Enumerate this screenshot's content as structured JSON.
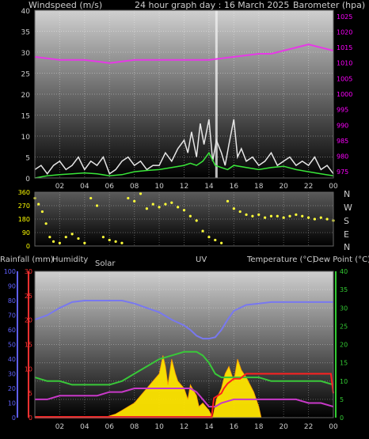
{
  "colors": {
    "background": "#000000",
    "panel_light": "#c8c8c8",
    "panel_dark": "#000000",
    "windspeed_gust": "#e6e6e6",
    "windspeed_avg": "#39e639",
    "barometer": "#e639e6",
    "wind_direction": "#ffff39",
    "humidity": "#7878f0",
    "temperature": "#39c839",
    "dew_point": "#c839c8",
    "rainfall": "#ff2020",
    "solar": "#ffe600",
    "uv": "#ff9a00",
    "axis_wind": "#cccccc",
    "axis_baro": "#ff00ff",
    "axis_dir": "#ffff00",
    "axis_hum": "#6060ff",
    "axis_rain": "#ff3030",
    "axis_temp": "#33cc33"
  },
  "header": {
    "windspeed_label": "Windspeed (m/s)",
    "title": "24 hour graph day : 16 March 2025",
    "barometer_label": "Barometer (hpa)"
  },
  "compass": {
    "n": "N",
    "w": "W",
    "s": "S",
    "e": "E",
    "n2": "N"
  },
  "bottom_header": {
    "rainfall": "Rainfall (mm)",
    "humidity": "Humidity",
    "solar": "Solar",
    "uv": "UV",
    "temperature": "Temperature (°C)",
    "dew_point": "Dew Point (°C)"
  },
  "chart_data": [
    {
      "type": "line",
      "x_ticks": [
        "02",
        "04",
        "06",
        "08",
        "10",
        "12",
        "14",
        "16",
        "18",
        "20",
        "22",
        "00"
      ],
      "x_hours": [
        0,
        24
      ],
      "y_left_ticks": [
        "0",
        "5",
        "10",
        "15",
        "20",
        "25",
        "30",
        "35",
        "40"
      ],
      "y_left_lim": [
        0,
        40
      ],
      "y_right_ticks": [
        "975",
        "980",
        "985",
        "990",
        "995",
        "1000",
        "1005",
        "1010",
        "1015",
        "1020",
        "1025"
      ],
      "y_right_lim": [
        973,
        1027
      ],
      "grid": true,
      "series": [
        {
          "role": "barometer",
          "axis": "right",
          "x": [
            0,
            2,
            4,
            6,
            8,
            10,
            12,
            14,
            16,
            18,
            19,
            20,
            21,
            22,
            23,
            24
          ],
          "y": [
            1012,
            1011,
            1011,
            1010,
            1011,
            1011,
            1011,
            1011,
            1012,
            1013,
            1013,
            1014,
            1015,
            1016,
            1015,
            1014
          ]
        },
        {
          "role": "gust",
          "axis": "left",
          "x": [
            0,
            0.5,
            1,
            1.5,
            2,
            2.5,
            3,
            3.5,
            4,
            4.5,
            5,
            5.5,
            6,
            6.5,
            7,
            7.5,
            8,
            8.5,
            9,
            9.5,
            10,
            10.5,
            11,
            11.5,
            12,
            12.3,
            12.6,
            13,
            13.3,
            13.6,
            14,
            14.3,
            14.6,
            15,
            15.3,
            15.6,
            16,
            16.3,
            16.6,
            17,
            17.5,
            18,
            18.5,
            19,
            19.5,
            20,
            20.5,
            21,
            21.5,
            22,
            22.5,
            23,
            23.5,
            24
          ],
          "y": [
            2,
            3,
            1,
            3,
            4,
            2,
            3,
            5,
            2,
            4,
            3,
            5,
            1,
            2,
            4,
            5,
            3,
            4,
            2,
            3,
            3,
            6,
            4,
            7,
            9,
            6,
            11,
            5,
            13,
            8,
            14,
            4,
            9,
            6,
            3,
            8,
            14,
            5,
            7,
            4,
            5,
            3,
            4,
            6,
            3,
            4,
            5,
            3,
            4,
            3,
            5,
            2,
            3,
            1
          ]
        },
        {
          "role": "avg",
          "axis": "left",
          "x": [
            0,
            1,
            2,
            3,
            4,
            5,
            6,
            7,
            8,
            9,
            10,
            11,
            12,
            12.5,
            13,
            13.5,
            14,
            14.5,
            15,
            15.5,
            16,
            17,
            18,
            19,
            20,
            21,
            22,
            23,
            24
          ],
          "y": [
            0,
            0.5,
            0.8,
            1,
            1.2,
            1,
            0.5,
            0.8,
            1.5,
            1.8,
            2,
            2.5,
            3,
            3.5,
            3,
            4,
            6,
            3,
            2.5,
            2,
            3,
            2.5,
            2,
            2.5,
            2.8,
            2,
            1.5,
            1,
            0.5
          ]
        }
      ],
      "spike": {
        "x": 14.6,
        "y": 40
      }
    },
    {
      "type": "scatter",
      "x_ticks": [
        "02",
        "04",
        "06",
        "08",
        "10",
        "12",
        "14",
        "16",
        "18",
        "20",
        "22",
        "00"
      ],
      "y_ticks": [
        "0",
        "90",
        "180",
        "270",
        "360"
      ],
      "y_lim": [
        0,
        360
      ],
      "series": [
        {
          "role": "direction",
          "x": [
            0,
            0.3,
            0.6,
            0.9,
            1.2,
            1.5,
            2,
            2.5,
            3,
            3.5,
            4,
            4.5,
            5,
            5.5,
            6,
            6.5,
            7,
            7.5,
            8,
            8.5,
            9,
            9.5,
            10,
            10.5,
            11,
            11.5,
            12,
            12.5,
            13,
            13.5,
            14,
            14.5,
            15,
            15.5,
            16,
            16.5,
            17,
            17.5,
            18,
            18.5,
            19,
            19.5,
            20,
            20.5,
            21,
            21.5,
            22,
            22.5,
            23,
            23.5,
            24
          ],
          "y": [
            320,
            280,
            230,
            150,
            60,
            30,
            20,
            60,
            80,
            50,
            20,
            320,
            270,
            60,
            40,
            30,
            20,
            320,
            300,
            350,
            250,
            280,
            260,
            280,
            290,
            260,
            240,
            200,
            170,
            100,
            60,
            40,
            20,
            300,
            250,
            230,
            210,
            200,
            210,
            190,
            200,
            200,
            190,
            200,
            210,
            200,
            190,
            180,
            190,
            180,
            170
          ]
        }
      ]
    },
    {
      "type": "area",
      "x_ticks": [
        "02",
        "04",
        "06",
        "08",
        "10",
        "12",
        "14",
        "16",
        "18",
        "20",
        "22",
        "00"
      ],
      "y_hum_ticks": [
        "0",
        "10",
        "20",
        "30",
        "40",
        "50",
        "60",
        "70",
        "80",
        "90",
        "100"
      ],
      "y_hum_lim": [
        0,
        100
      ],
      "y_rain_ticks": [
        "0",
        "5",
        "10",
        "15",
        "20",
        "25",
        "30"
      ],
      "y_rain_lim": [
        0,
        30
      ],
      "y_temp_ticks": [
        "0",
        "5",
        "10",
        "15",
        "20",
        "25",
        "30",
        "35",
        "40"
      ],
      "y_temp_lim": [
        0,
        40
      ],
      "series": [
        {
          "role": "humidity",
          "axis": "hum",
          "x": [
            0,
            1,
            2,
            3,
            4,
            5,
            6,
            7,
            8,
            9,
            10,
            11,
            12,
            12.5,
            13,
            13.5,
            14,
            14.5,
            15,
            15.5,
            16,
            17,
            18,
            19,
            20,
            21,
            22,
            23,
            24
          ],
          "y": [
            67,
            70,
            75,
            79,
            80,
            80,
            80,
            80,
            78,
            75,
            72,
            67,
            63,
            60,
            56,
            54,
            54,
            55,
            60,
            67,
            73,
            77,
            78,
            79,
            79,
            79,
            79,
            79,
            79
          ]
        },
        {
          "role": "temperature",
          "axis": "temp",
          "x": [
            0,
            1,
            2,
            3,
            4,
            5,
            6,
            7,
            8,
            9,
            10,
            11,
            12,
            12.5,
            13,
            13.5,
            14,
            14.5,
            15,
            15.5,
            16,
            17,
            18,
            19,
            20,
            21,
            22,
            23,
            24
          ],
          "y": [
            11,
            10,
            10,
            9,
            9,
            9,
            9,
            10,
            12,
            14,
            16,
            17,
            18,
            18,
            18,
            17,
            15,
            12,
            11,
            11,
            11,
            11,
            11,
            10,
            10,
            10,
            10,
            10,
            9
          ]
        },
        {
          "role": "dew_point",
          "axis": "temp",
          "x": [
            0,
            1,
            2,
            3,
            4,
            5,
            6,
            7,
            8,
            9,
            10,
            11,
            12,
            12.5,
            13,
            13.5,
            14,
            14.5,
            15,
            16,
            17,
            18,
            19,
            20,
            21,
            22,
            23,
            24
          ],
          "y": [
            5,
            5,
            6,
            6,
            6,
            6,
            7,
            7,
            8,
            8,
            8,
            8,
            8,
            8,
            7,
            5,
            3,
            3,
            4,
            5,
            5,
            5,
            5,
            5,
            5,
            4,
            4,
            3
          ]
        },
        {
          "role": "rain",
          "axis": "rain",
          "x": [
            0,
            14.2,
            14.4,
            15,
            15.2,
            15.5,
            16,
            16.5,
            17,
            17.5,
            18,
            19,
            20,
            21,
            22,
            23,
            23.8,
            24
          ],
          "y": [
            0,
            0,
            4,
            5,
            6,
            7,
            8,
            8,
            9,
            9,
            9,
            9,
            9,
            9,
            9,
            9,
            9,
            5
          ]
        },
        {
          "role": "solar",
          "axis": "temp",
          "x": [
            5.6,
            6,
            6.5,
            7,
            7.5,
            8,
            8.5,
            9,
            9.5,
            10,
            10.3,
            10.5,
            10.7,
            11,
            11.3,
            11.5,
            12,
            12.3,
            12.5,
            13,
            13.2,
            13.5,
            14,
            14.3,
            14.6,
            15,
            15.3,
            15.6,
            16,
            16.3,
            16.6,
            17,
            17.3,
            17.6,
            18,
            18.2
          ],
          "y": [
            0,
            0.5,
            1,
            2,
            3,
            4,
            6,
            8,
            10,
            12,
            17,
            14,
            9,
            16,
            12,
            10,
            8,
            5,
            9,
            6,
            3,
            4,
            2,
            0,
            5,
            8,
            12,
            14,
            10,
            16,
            13,
            11,
            9,
            7,
            3,
            0
          ]
        }
      ]
    }
  ]
}
